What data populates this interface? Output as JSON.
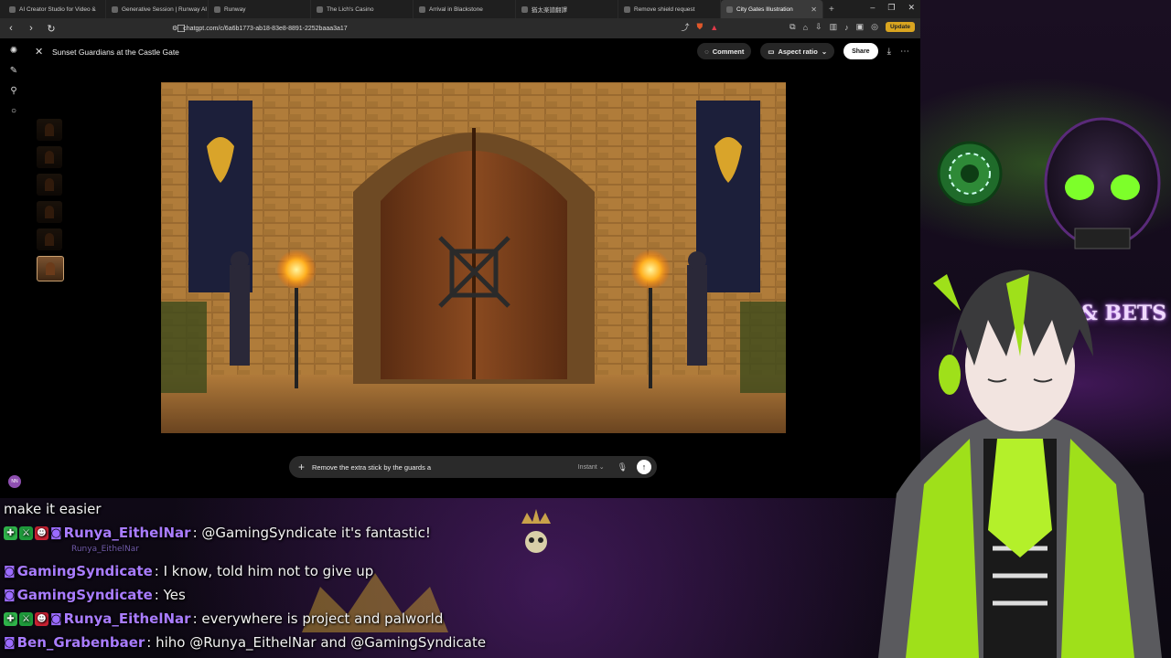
{
  "browser": {
    "tabs": [
      {
        "label": "AI Creator Studio for Video &"
      },
      {
        "label": "Generative Session | Runway AI"
      },
      {
        "label": "Runway"
      },
      {
        "label": "The Lich's Casino"
      },
      {
        "label": "Arrival in Blackstone"
      },
      {
        "label": "猶太楽譜翻譯"
      },
      {
        "label": "Remove shield request"
      },
      {
        "label": "City Gates Illustration"
      }
    ],
    "url": "chatgpt.com/c/6a6b1773-ab18-83e8-8891-2252baaa3a17",
    "update_label": "Update"
  },
  "app": {
    "title": "Sunset Guardians at the Castle Gate",
    "comment_label": "Comment",
    "aspect_label": "Aspect ratio",
    "share_label": "Share",
    "composer_text": "Remove the extra stick by the guards a",
    "mode_label": "Instant",
    "avatar_initials": "NN"
  },
  "chat": [
    {
      "user": "",
      "text": "make it easier"
    },
    {
      "user": "Runya_EithelNar",
      "text": ": @GamingSyndicate it's fantastic!"
    },
    {
      "user": "",
      "text": "Runya_EithelNar",
      "reply": true
    },
    {
      "user": "GamingSyndicate",
      "text": ": I know, told him not to give up"
    },
    {
      "user": "GamingSyndicate",
      "text": ": Yes"
    },
    {
      "user": "Runya_EithelNar",
      "text": ": everywhere is project and palworld"
    },
    {
      "user": "Ben_Grabenbaer",
      "text": ": hiho @Runya_EithelNar and @GamingSyndicate"
    }
  ],
  "overlay": {
    "bets_sign": "& BETS"
  },
  "colors": {
    "accent_green": "#9fe01a",
    "chat_user": "#a97cff"
  }
}
